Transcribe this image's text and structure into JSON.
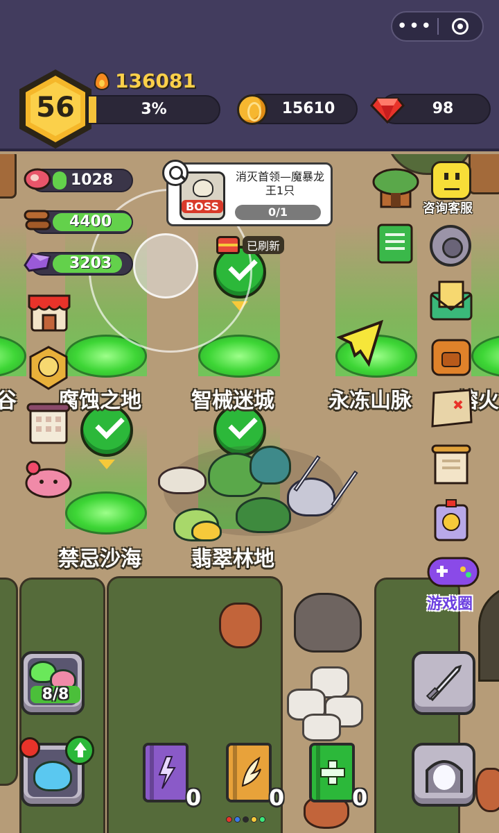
{
  "capsule": {
    "more": "•••"
  },
  "player": {
    "level": "56",
    "power": "136081",
    "exp_percent_label": "3%",
    "exp_fraction": 0.03
  },
  "currency": {
    "gold": "15610",
    "gems": "98"
  },
  "resources": {
    "meat": "1028",
    "wood": "4400",
    "crystal": "3203"
  },
  "quest": {
    "title": "消灭首领—魔暴龙王1只",
    "progress": "0/1",
    "boss_badge": "BOSS"
  },
  "refresh": {
    "label": "已刷新"
  },
  "zones": {
    "valley_partial": "谷",
    "corrosion": "腐蚀之地",
    "mecha": "智械迷城",
    "frozen": "永冻山脉",
    "fire_partial": "熔火",
    "desert": "禁忌沙海",
    "forest": "翡翠林地"
  },
  "side_menu": {
    "service": "咨询客服",
    "game_circle": "游戏圈"
  },
  "slots": {
    "label": "8/8"
  },
  "books": {
    "purple": "0",
    "gold": "0",
    "green": "0"
  },
  "colors": {
    "header_bg": "#423c5e",
    "gold": "#fbd04a",
    "green": "#63d14b",
    "accent_purple": "#6b3fe0"
  },
  "icons": [
    "more-dots-icon",
    "target-icon",
    "flame-icon",
    "coin-icon",
    "ruby-icon",
    "meat-icon",
    "wood-icon",
    "crystal-icon",
    "shop-icon",
    "medal-icon",
    "calendar-icon",
    "pig-icon",
    "magnifier-icon",
    "boss-icon",
    "chest-icon",
    "tree-house-icon",
    "chat-icon",
    "settings-gear-icon",
    "green-book-icon",
    "mail-icon",
    "backpack-icon",
    "map-icon",
    "scroll-icon",
    "potion-icon",
    "gamepad-icon",
    "sword-icon",
    "portal-icon",
    "slime-icon",
    "upgrade-arrow-icon"
  ]
}
